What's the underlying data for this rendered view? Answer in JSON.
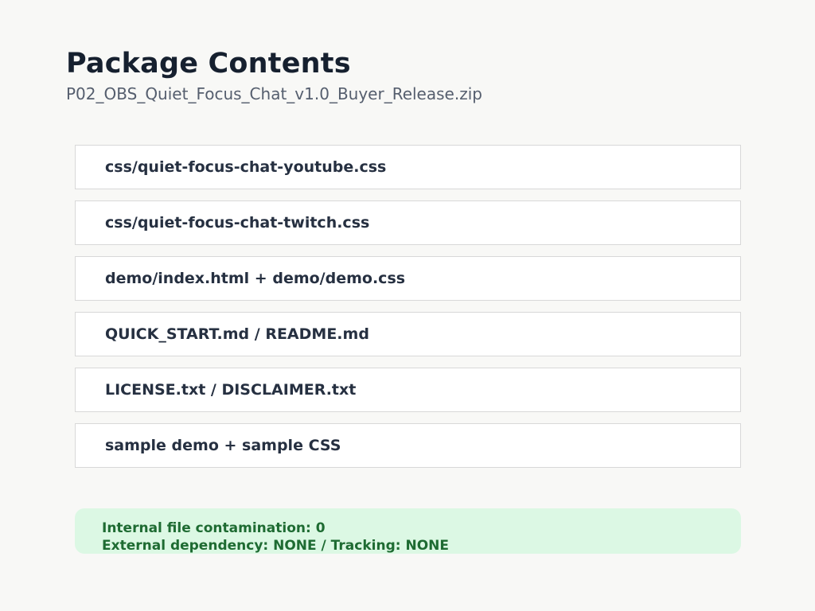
{
  "header": {
    "title": "Package Contents",
    "subtitle": "P02_OBS_Quiet_Focus_Chat_v1.0_Buyer_Release.zip"
  },
  "files": [
    {
      "label": "css/quiet-focus-chat-youtube.css"
    },
    {
      "label": "css/quiet-focus-chat-twitch.css"
    },
    {
      "label": "demo/index.html + demo/demo.css"
    },
    {
      "label": "QUICK_START.md / README.md"
    },
    {
      "label": "LICENSE.txt / DISCLAIMER.txt"
    },
    {
      "label": "sample demo + sample CSS"
    }
  ],
  "status": {
    "line1": "Internal file contamination: 0",
    "line2": "External dependency: NONE / Tracking: NONE",
    "color": "#1e6b32",
    "background": "#dcf8e4"
  }
}
